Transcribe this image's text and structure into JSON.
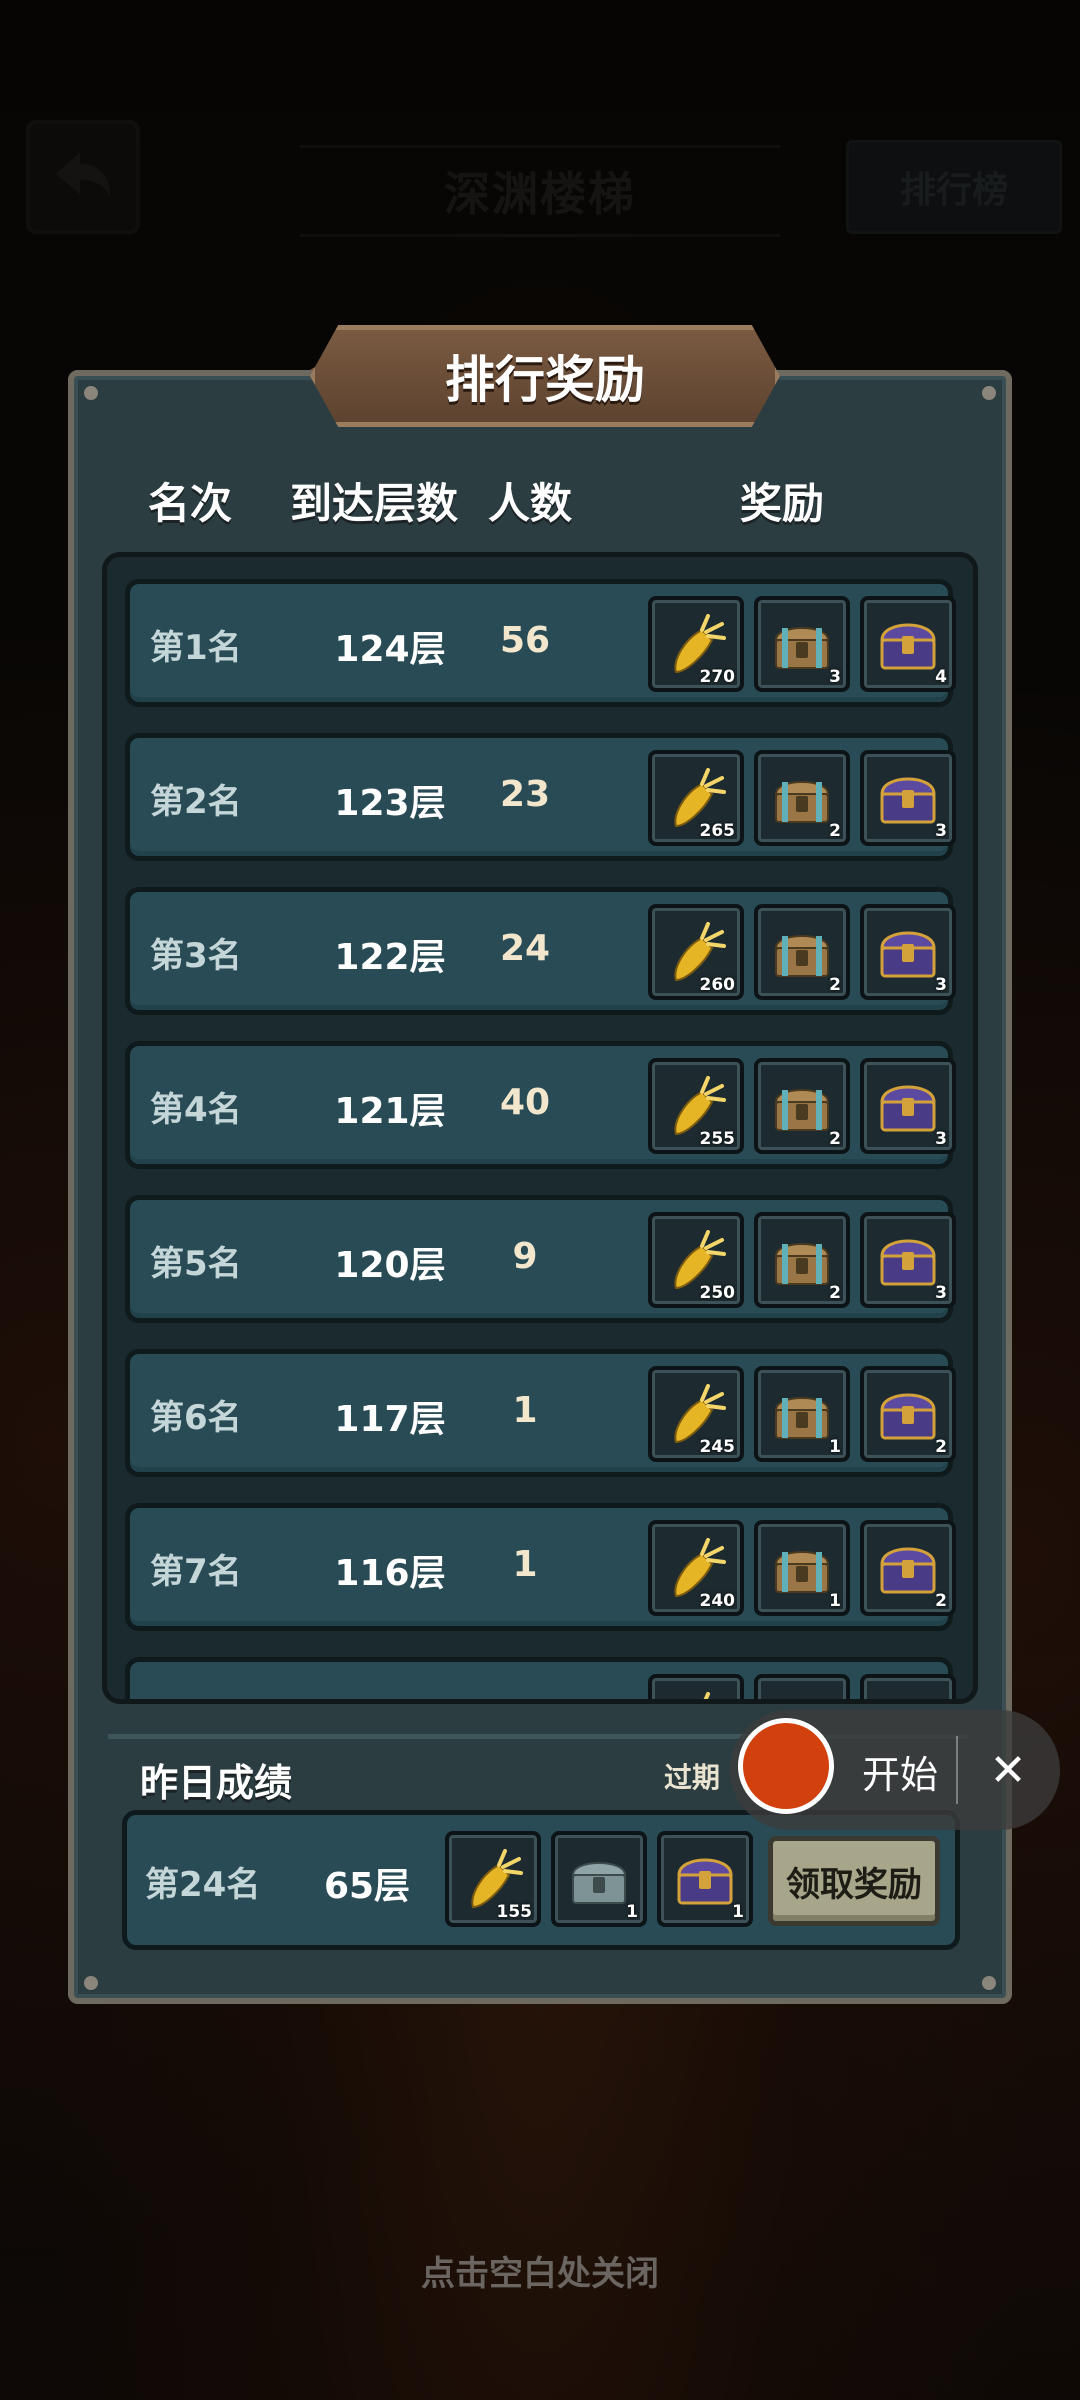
{
  "top_bar": {
    "title": "深渊楼梯",
    "ranking_button": "排行榜"
  },
  "modal": {
    "title": "排行奖励",
    "columns": [
      "名次",
      "到达层数",
      "人数",
      "奖励"
    ],
    "rows": [
      {
        "rank": "第1名",
        "floor": "124层",
        "count": "56",
        "rewards": [
          "270",
          "3",
          "4"
        ]
      },
      {
        "rank": "第2名",
        "floor": "123层",
        "count": "23",
        "rewards": [
          "265",
          "2",
          "3"
        ]
      },
      {
        "rank": "第3名",
        "floor": "122层",
        "count": "24",
        "rewards": [
          "260",
          "2",
          "3"
        ]
      },
      {
        "rank": "第4名",
        "floor": "121层",
        "count": "40",
        "rewards": [
          "255",
          "2",
          "3"
        ]
      },
      {
        "rank": "第5名",
        "floor": "120层",
        "count": "9",
        "rewards": [
          "250",
          "2",
          "3"
        ]
      },
      {
        "rank": "第6名",
        "floor": "117层",
        "count": "1",
        "rewards": [
          "245",
          "1",
          "2"
        ]
      },
      {
        "rank": "第7名",
        "floor": "116层",
        "count": "1",
        "rewards": [
          "240",
          "1",
          "2"
        ]
      }
    ],
    "yesterday": {
      "title": "昨日成绩",
      "expire_label": "过期",
      "rank": "第24名",
      "floor": "65层",
      "rewards": [
        "155",
        "1",
        "1"
      ],
      "claim_button": "领取奖励"
    }
  },
  "recorder": {
    "start_label": "开始",
    "close_glyph": "✕"
  },
  "close_hint": "点击空白处关闭",
  "colors": {
    "panel": "#2b3d41",
    "row": "#284b55",
    "plaque": "#6b4d37",
    "record_red": "#d2400e",
    "claim_button": "#a7a58a"
  }
}
